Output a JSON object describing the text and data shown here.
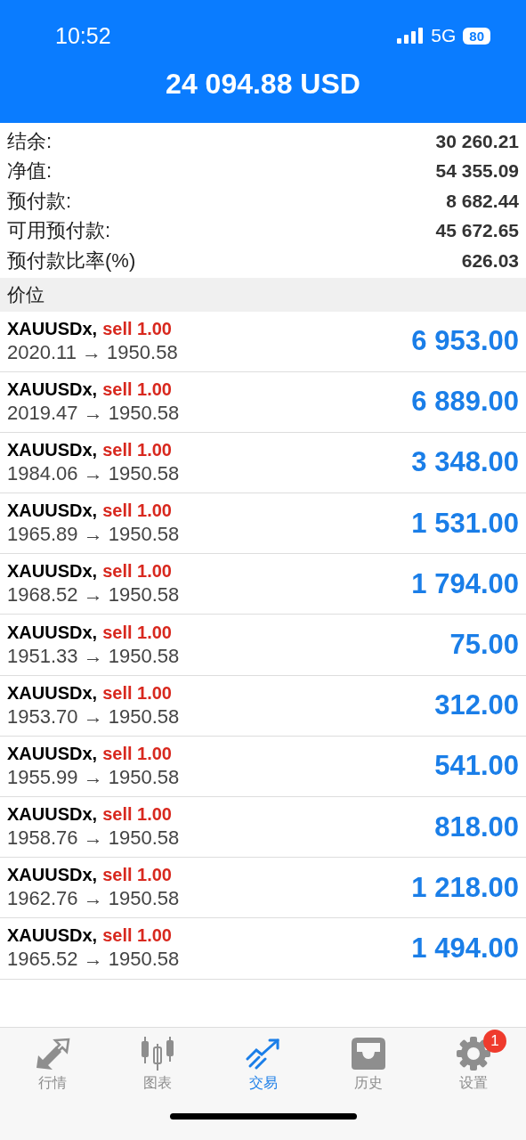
{
  "status_bar": {
    "time": "10:52",
    "network": "5G",
    "battery": "80"
  },
  "header": {
    "title": "24 094.88 USD"
  },
  "summary": [
    {
      "label": "结余:",
      "value": "30 260.21"
    },
    {
      "label": "净值:",
      "value": "54 355.09"
    },
    {
      "label": "预付款:",
      "value": "8 682.44"
    },
    {
      "label": "可用预付款:",
      "value": "45 672.65"
    },
    {
      "label": "预付款比率(%)",
      "value": "626.03"
    }
  ],
  "section": "价位",
  "trades": [
    {
      "symbol": "XAUUSDx,",
      "order": "sell 1.00",
      "prices": "2020.11 → 1950.58",
      "profit": "6 953.00"
    },
    {
      "symbol": "XAUUSDx,",
      "order": "sell 1.00",
      "prices": "2019.47 → 1950.58",
      "profit": "6 889.00"
    },
    {
      "symbol": "XAUUSDx,",
      "order": "sell 1.00",
      "prices": "1984.06 → 1950.58",
      "profit": "3 348.00"
    },
    {
      "symbol": "XAUUSDx,",
      "order": "sell 1.00",
      "prices": "1965.89 → 1950.58",
      "profit": "1 531.00"
    },
    {
      "symbol": "XAUUSDx,",
      "order": "sell 1.00",
      "prices": "1968.52 → 1950.58",
      "profit": "1 794.00"
    },
    {
      "symbol": "XAUUSDx,",
      "order": "sell 1.00",
      "prices": "1951.33 → 1950.58",
      "profit": "75.00"
    },
    {
      "symbol": "XAUUSDx,",
      "order": "sell 1.00",
      "prices": "1953.70 → 1950.58",
      "profit": "312.00"
    },
    {
      "symbol": "XAUUSDx,",
      "order": "sell 1.00",
      "prices": "1955.99 → 1950.58",
      "profit": "541.00"
    },
    {
      "symbol": "XAUUSDx,",
      "order": "sell 1.00",
      "prices": "1958.76 → 1950.58",
      "profit": "818.00"
    },
    {
      "symbol": "XAUUSDx,",
      "order": "sell 1.00",
      "prices": "1962.76 → 1950.58",
      "profit": "1 218.00"
    },
    {
      "symbol": "XAUUSDx,",
      "order": "sell 1.00",
      "prices": "1965.52 → 1950.58",
      "profit": "1 494.00"
    }
  ],
  "tabs": [
    {
      "kind": "quotes",
      "label": "行情",
      "selected": false
    },
    {
      "kind": "chart",
      "label": "图表",
      "selected": false
    },
    {
      "kind": "trade",
      "label": "交易",
      "selected": true
    },
    {
      "kind": "history",
      "label": "历史",
      "selected": false
    },
    {
      "kind": "settings",
      "label": "设置",
      "selected": false,
      "badge": "1"
    }
  ]
}
